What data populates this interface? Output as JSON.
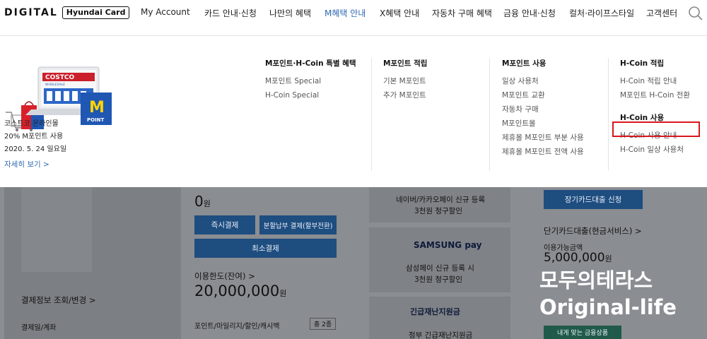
{
  "header": {
    "logo_main": "DIGITAL",
    "logo_sub": "Hyundai Card",
    "nav": [
      {
        "label": "My Account"
      },
      {
        "label": "카드 안내·신청"
      },
      {
        "label": "나만의 혜택"
      },
      {
        "label": "M혜택 안내",
        "active": true
      },
      {
        "label": "X혜택 안내"
      },
      {
        "label": "자동차 구매 혜택"
      },
      {
        "label": "금융 안내·신청"
      },
      {
        "label": "컬처·라이프스타일"
      },
      {
        "label": "고객센터"
      }
    ],
    "search_icon": "search-icon"
  },
  "promo": {
    "store_sign": "COSTCO",
    "store_sign_sub": "WHOLESALE",
    "badge_letter": "M",
    "badge_text": "POINT",
    "line1": "코스트코 온라인몰",
    "line2": "20% M포인트 사용",
    "line3": "2020. 5. 24 일요일",
    "link": "자세히 보기 >"
  },
  "menu": {
    "col1": {
      "title": "M포인트·H-Coin 특별 혜택",
      "items": [
        "M포인트 Special",
        "H-Coin Special"
      ]
    },
    "col2": {
      "title": "M포인트 적립",
      "items": [
        "기본 M포인트",
        "추가 M포인트"
      ]
    },
    "col3": {
      "title": "M포인트 사용",
      "items": [
        "일상 사용처",
        "M포인트 교환",
        "자동차 구매",
        "M포인트몰",
        "제휴몰 M포인트 부분 사용",
        "제휴몰 M포인트 전액 사용"
      ]
    },
    "col4": {
      "title": "H-Coin 적립",
      "items": [
        "H-Coin 적립 안내",
        "M포인트 H-Coin 전환"
      ]
    },
    "col5": {
      "title": "H-Coin 사용",
      "items": [
        "H-Coin 사용 안내",
        "H-Coin 일상 사용처"
      ]
    },
    "highlight_color": "#d8171e"
  },
  "background": {
    "amount_zero": "0",
    "won": "원",
    "btn_instant": "즉시결제",
    "btn_installment": "분할납부 결제(할부전환)",
    "btn_min": "최소결제",
    "limit_label": "이용한도(잔여) >",
    "limit_value": "20,000,000",
    "points_label": "포인트/마일리지/할인/캐시백",
    "total_badge": "총 2종",
    "pay_info": "결제정보 조회/변경 >",
    "pay_date": "결제일/계좌",
    "naver_line1": "네이버/카카오페이 신규 등록",
    "naver_line2": "3천원 청구할인",
    "samsung_logo": "SAMSUNG pay",
    "samsung_line1": "삼성페이 신규 등록 시",
    "samsung_line2": "3천원 청구할인",
    "disaster_title": "긴급재난지원금",
    "disaster_line": "정부 긴급재난지원금",
    "loan_btn": "장기카드대출 신청",
    "cash_label": "단기카드대출(현금서비스) >",
    "cash_avail": "이용가능금액",
    "cash_value": "5,000,000",
    "finance_btn": "내게 맞는 금융상품"
  },
  "watermark": {
    "line1": "모두의테라스",
    "line2": "Original-life"
  },
  "colors": {
    "accent": "#2f68b4",
    "dim_bg": "#8a8d91",
    "button": "#1e4d80"
  }
}
